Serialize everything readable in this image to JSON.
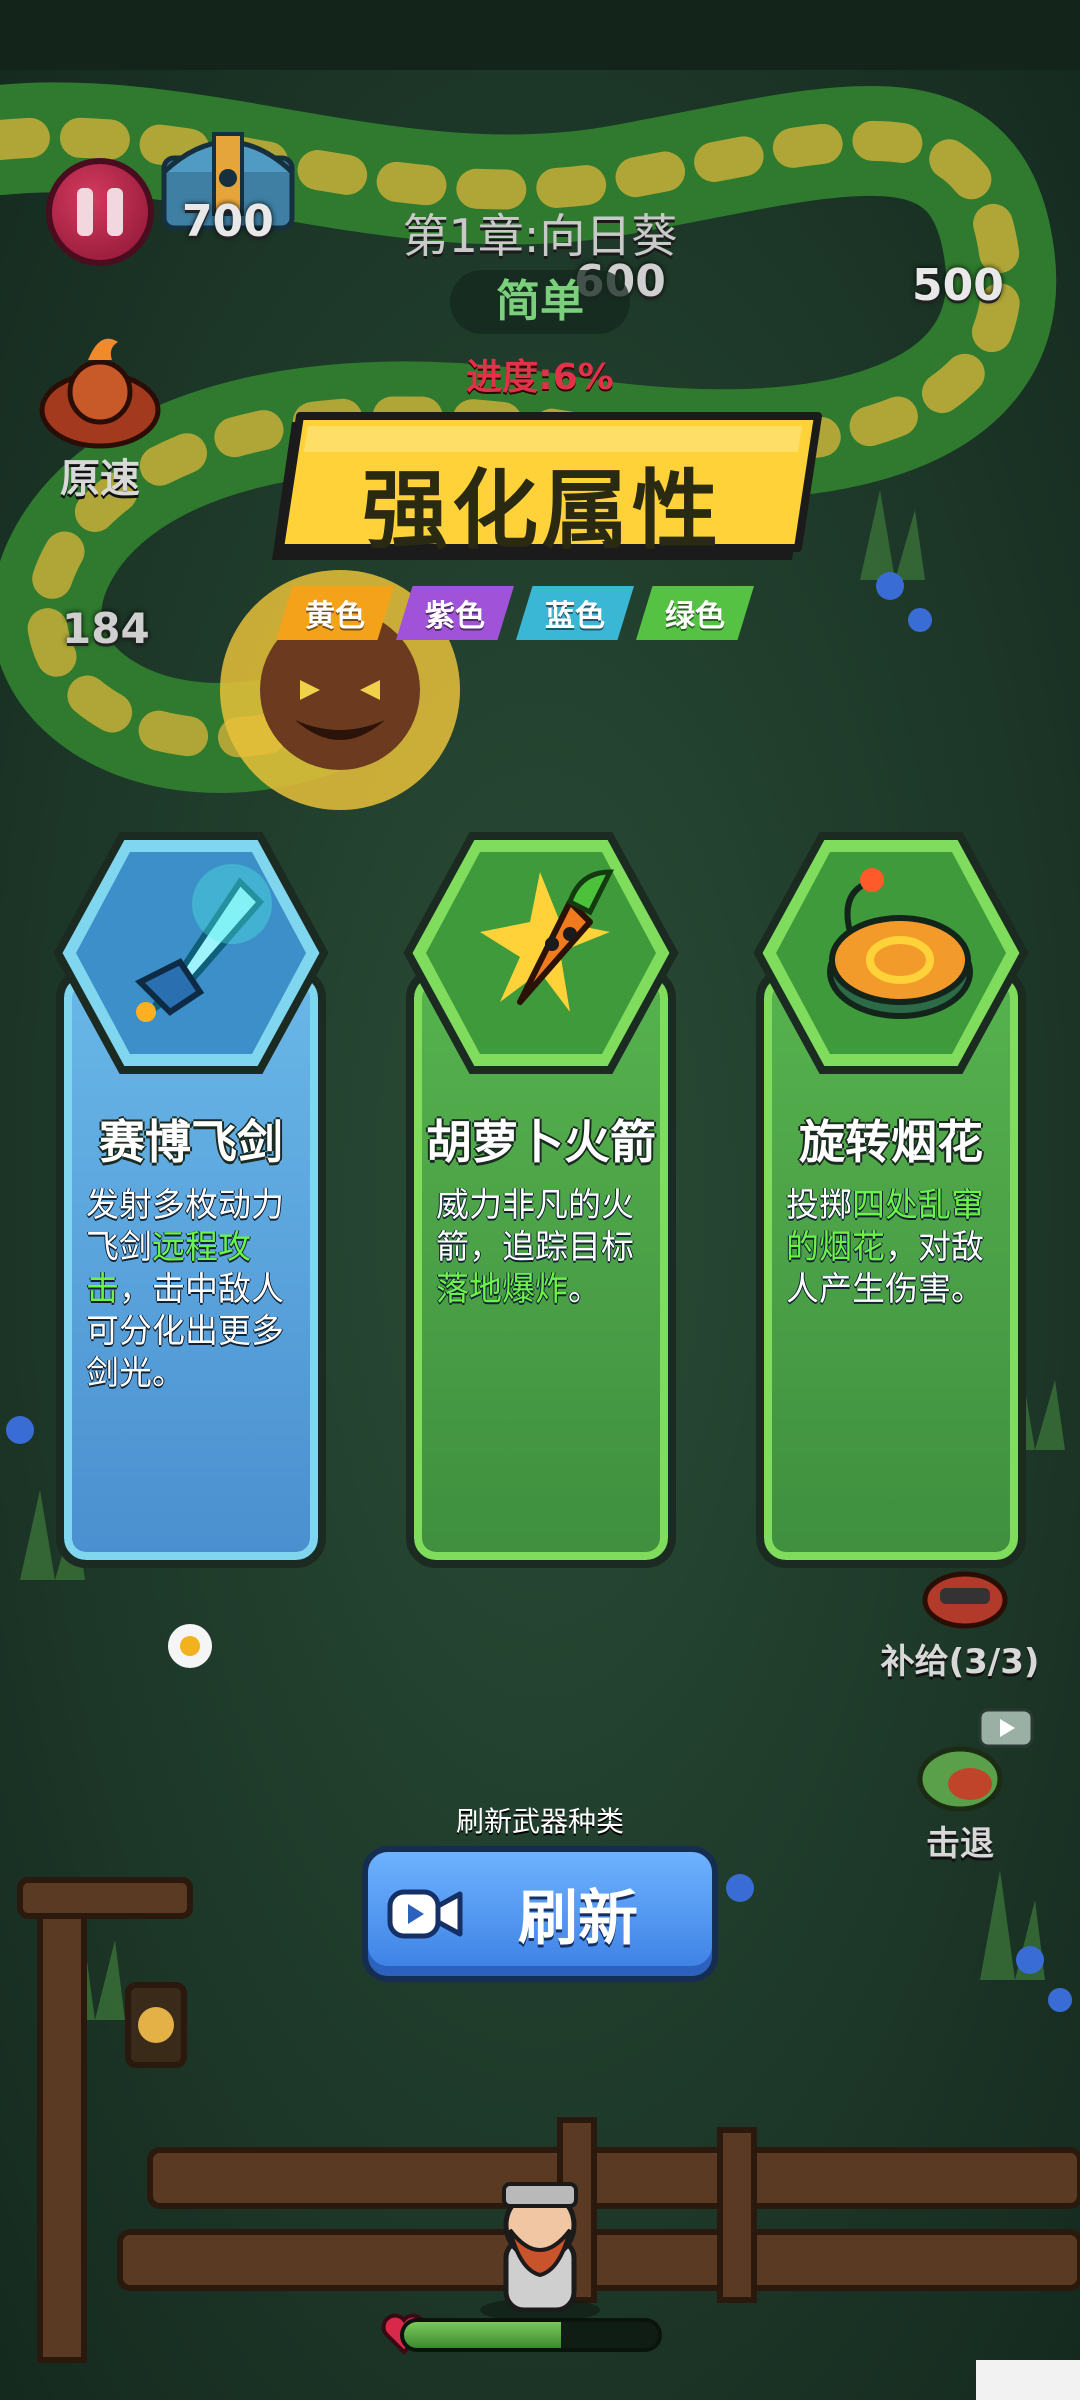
{
  "hud": {
    "chest_count": "700",
    "chapter_title": "第1章:向日葵",
    "difficulty": "简单",
    "progress": "进度:6%",
    "speed_label": "原速",
    "enemy_hp_left": "184",
    "enemy_hp_mid": "600",
    "enemy_hp_right": "500"
  },
  "panel": {
    "title": "强化属性",
    "color_tags": [
      {
        "label": "黄色",
        "color": "#f5a21b"
      },
      {
        "label": "紫色",
        "color": "#a052d8"
      },
      {
        "label": "蓝色",
        "color": "#3bb7d6"
      },
      {
        "label": "绿色",
        "color": "#55c244"
      }
    ]
  },
  "cards": [
    {
      "title": "赛博飞剑",
      "icon": "cyber-flying-sword-icon",
      "theme": "#4c97d6",
      "desc_parts": [
        "发射多枚动力飞剑",
        "远程攻击",
        "，击中敌人可分化出更多剑光。"
      ]
    },
    {
      "title": "胡萝卜火箭",
      "icon": "carrot-rocket-icon",
      "theme": "#4da84a",
      "desc_parts": [
        "威力非凡的火箭，追踪目标",
        "落地爆炸",
        "。"
      ]
    },
    {
      "title": "旋转烟花",
      "icon": "spinning-firework-icon",
      "theme": "#4da84a",
      "desc_parts": [
        "投掷",
        "四处乱窜的烟花",
        "，对敌人产生伤害。"
      ]
    }
  ],
  "side_buttons": {
    "supply_label": "补给(3/3)",
    "knockback_label": "击退"
  },
  "refresh": {
    "caption": "刷新武器种类",
    "label": "刷新"
  },
  "player": {
    "hp_fraction": 0.62
  }
}
